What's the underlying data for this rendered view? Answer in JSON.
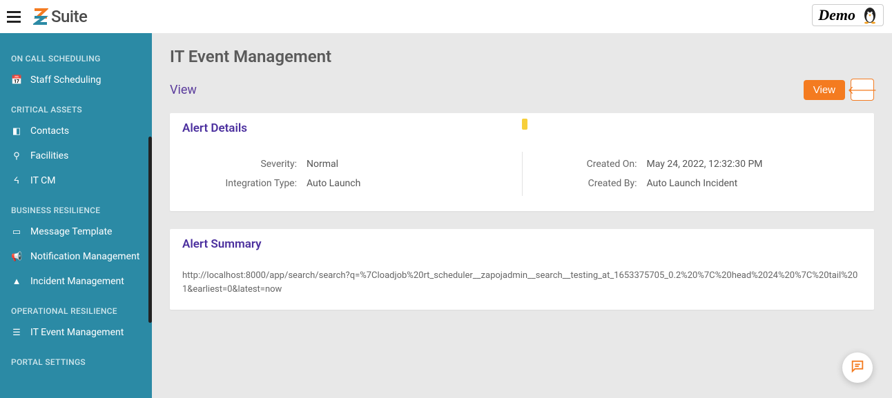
{
  "brand": {
    "name": "Suite"
  },
  "demo_label": "Demo",
  "sidebar": {
    "sections": [
      {
        "header": "ON CALL SCHEDULING",
        "items": [
          {
            "icon": "calendar",
            "label": "Staff Scheduling"
          }
        ]
      },
      {
        "header": "CRITICAL ASSETS",
        "items": [
          {
            "icon": "contact",
            "label": "Contacts"
          },
          {
            "icon": "facility",
            "label": "Facilities"
          },
          {
            "icon": "itcm",
            "label": "IT CM"
          }
        ]
      },
      {
        "header": "BUSINESS RESILIENCE",
        "items": [
          {
            "icon": "message",
            "label": "Message Template"
          },
          {
            "icon": "bullhorn",
            "label": "Notification Management"
          },
          {
            "icon": "alert",
            "label": "Incident Management"
          }
        ]
      },
      {
        "header": "OPERATIONAL RESILIENCE",
        "items": [
          {
            "icon": "list",
            "label": "IT Event Management"
          }
        ]
      },
      {
        "header": "PORTAL SETTINGS",
        "items": []
      }
    ]
  },
  "page": {
    "title": "IT Event Management",
    "breadcrumb": "View",
    "view_btn": "View"
  },
  "alert_details": {
    "title": "Alert Details",
    "severity_label": "Severity:",
    "severity_value": "Normal",
    "integration_label": "Integration Type:",
    "integration_value": "Auto Launch",
    "created_on_label": "Created On:",
    "created_on_value": "May 24, 2022, 12:32:30 PM",
    "created_by_label": "Created By:",
    "created_by_value": "Auto Launch Incident"
  },
  "alert_summary": {
    "title": "Alert Summary",
    "body": "http://localhost:8000/app/search/search?q=%7Cloadjob%20rt_scheduler__zapojadmin__search__testing_at_1653375705_0.2%20%7C%20head%2024%20%7C%20tail%201&earliest=0&latest=now"
  }
}
